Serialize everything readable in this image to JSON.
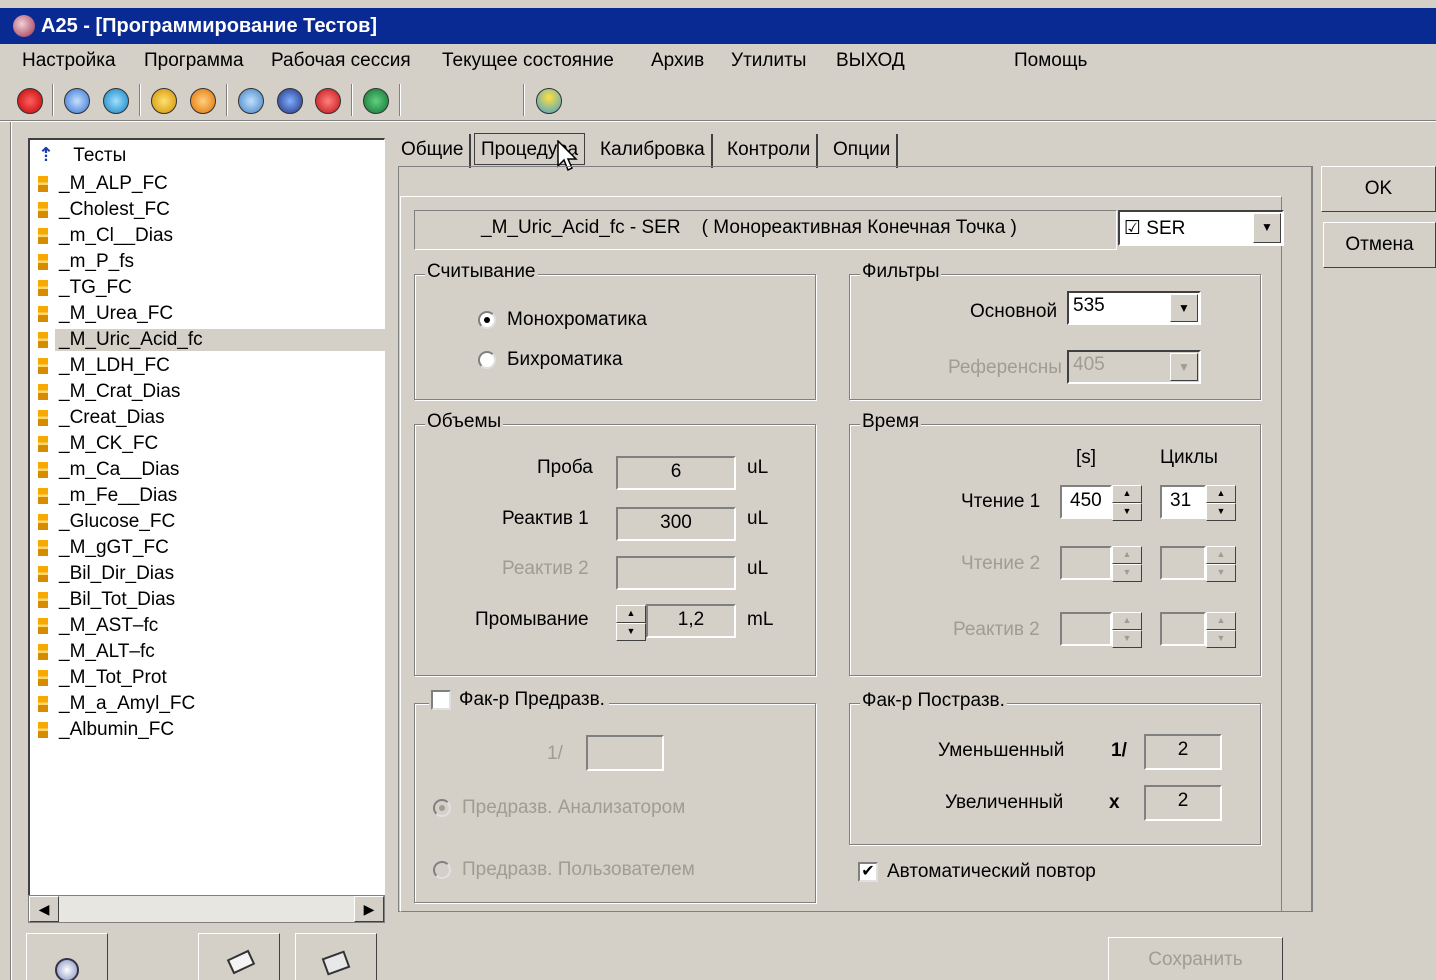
{
  "window": {
    "title": "A25 - [Программирование Тестов]"
  },
  "menu": [
    "Настройка",
    "Программа",
    "Рабочая сессия",
    "Текущее состояние",
    "Архив",
    "Утилиты",
    "ВЫХОД",
    "Помощь"
  ],
  "toolbar_icons": [
    "a25-logo-icon",
    "snowflake-icon",
    "reagent-rack-icon",
    "info-icon",
    "sample-rack-icon",
    "eye-icon",
    "stack-icon",
    "alarm-icon",
    "wrench-icon",
    "sun-icon"
  ],
  "tree": {
    "header": "Тесты",
    "items": [
      "_M_ALP_FC",
      "_Cholest_FC",
      "_m_Cl__Dias",
      "_m_P_fs",
      "_TG_FC",
      "_M_Urea_FC",
      "_M_Uric_Acid_fc",
      "_M_LDH_FC",
      "_M_Crat_Dias",
      "_Creat_Dias",
      "_M_CK_FC",
      "_m_Ca__Dias",
      "_m_Fe__Dias",
      "_Glucose_FC",
      "_M_gGT_FC",
      "_Bil_Dir_Dias",
      "_Bil_Tot_Dias",
      "_M_AST–fc",
      "_M_ALT–fc",
      "_M_Tot_Prot",
      "_M_a_Amyl_FC",
      "_Albumin_FC"
    ],
    "selected": "_M_Uric_Acid_fc"
  },
  "tabs": [
    "Общие",
    "Процедура",
    "Калибровка",
    "Контроли",
    "Опции"
  ],
  "active_tab": "Процедура",
  "test_header": "_M_Uric_Acid_fc - SER    ( Монореактивная Конечная Точка )",
  "sample_type": "☑ SER",
  "reading": {
    "title": "Считывание",
    "mono": "Монохроматика",
    "bi": "Бихроматика",
    "selected": "Монохроматика"
  },
  "filters": {
    "title": "Фильтры",
    "main_label": "Основной",
    "main_value": "535",
    "ref_label": "Референсны",
    "ref_value": "405"
  },
  "volumes": {
    "title": "Объемы",
    "sample_label": "Проба",
    "sample_value": "6",
    "sample_unit": "uL",
    "r1_label": "Реактив 1",
    "r1_value": "300",
    "r1_unit": "uL",
    "r2_label": "Реактив 2",
    "r2_value": "",
    "r2_unit": "uL",
    "wash_label": "Промывание",
    "wash_value": "1,2",
    "wash_unit": "mL"
  },
  "time": {
    "title": "Время",
    "col_s": "[s]",
    "col_cycles": "Циклы",
    "read1_label": "Чтение 1",
    "read1_s": "450",
    "read1_cycles": "31",
    "read2_label": "Чтение 2",
    "r2_label": "Реактив 2"
  },
  "predil": {
    "title": "Фак-р Предразв.",
    "prefix": "1/",
    "by_analyzer": "Предразв. Анализатором",
    "by_user": "Предразв. Пользователем"
  },
  "postdil": {
    "title": "Фак-р Постразв.",
    "dec_label": "Уменьшенный",
    "dec_op": "1/",
    "dec_value": "2",
    "inc_label": "Увеличенный",
    "inc_op": "x",
    "inc_value": "2"
  },
  "auto_repeat": "Автоматический повтор",
  "buttons": {
    "ok": "OK",
    "cancel": "Отмена",
    "save": "Сохранить"
  },
  "colors": {
    "titlebar": "#0a2a93",
    "face": "#d4d0c8",
    "disabled_text": "#a09c94"
  }
}
